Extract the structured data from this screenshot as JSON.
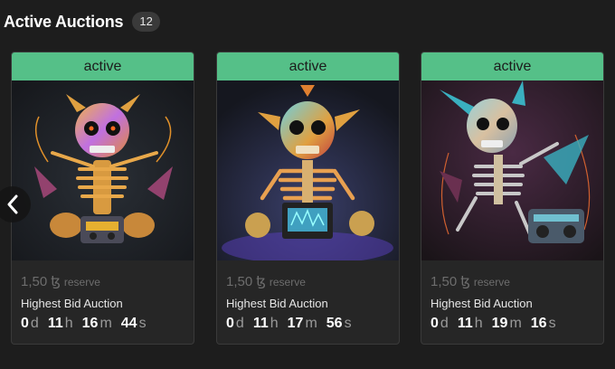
{
  "header": {
    "title": "Active Auctions",
    "count": "12"
  },
  "nav": {
    "prev_icon": "chevron-left-icon"
  },
  "colors": {
    "status_active": "#55c088",
    "background": "#1d1d1d",
    "card": "#262626"
  },
  "cards": [
    {
      "status": "active",
      "artwork_icon": "skeleton-artwork-image",
      "price": "1,50",
      "currency": "ꜩ",
      "reserve_label": "reserve",
      "auction_type": "Highest Bid Auction",
      "timer": {
        "d": "0",
        "h": "11",
        "m": "16",
        "s": "44",
        "du": "d",
        "hu": "h",
        "mu": "m",
        "su": "s"
      }
    },
    {
      "status": "active",
      "artwork_icon": "skeleton-artwork-image",
      "price": "1,50",
      "currency": "ꜩ",
      "reserve_label": "reserve",
      "auction_type": "Highest Bid Auction",
      "timer": {
        "d": "0",
        "h": "11",
        "m": "17",
        "s": "56",
        "du": "d",
        "hu": "h",
        "mu": "m",
        "su": "s"
      }
    },
    {
      "status": "active",
      "artwork_icon": "skeleton-artwork-image",
      "price": "1,50",
      "currency": "ꜩ",
      "reserve_label": "reserve",
      "auction_type": "Highest Bid Auction",
      "timer": {
        "d": "0",
        "h": "11",
        "m": "19",
        "s": "16",
        "du": "d",
        "hu": "h",
        "mu": "m",
        "su": "s"
      }
    }
  ]
}
